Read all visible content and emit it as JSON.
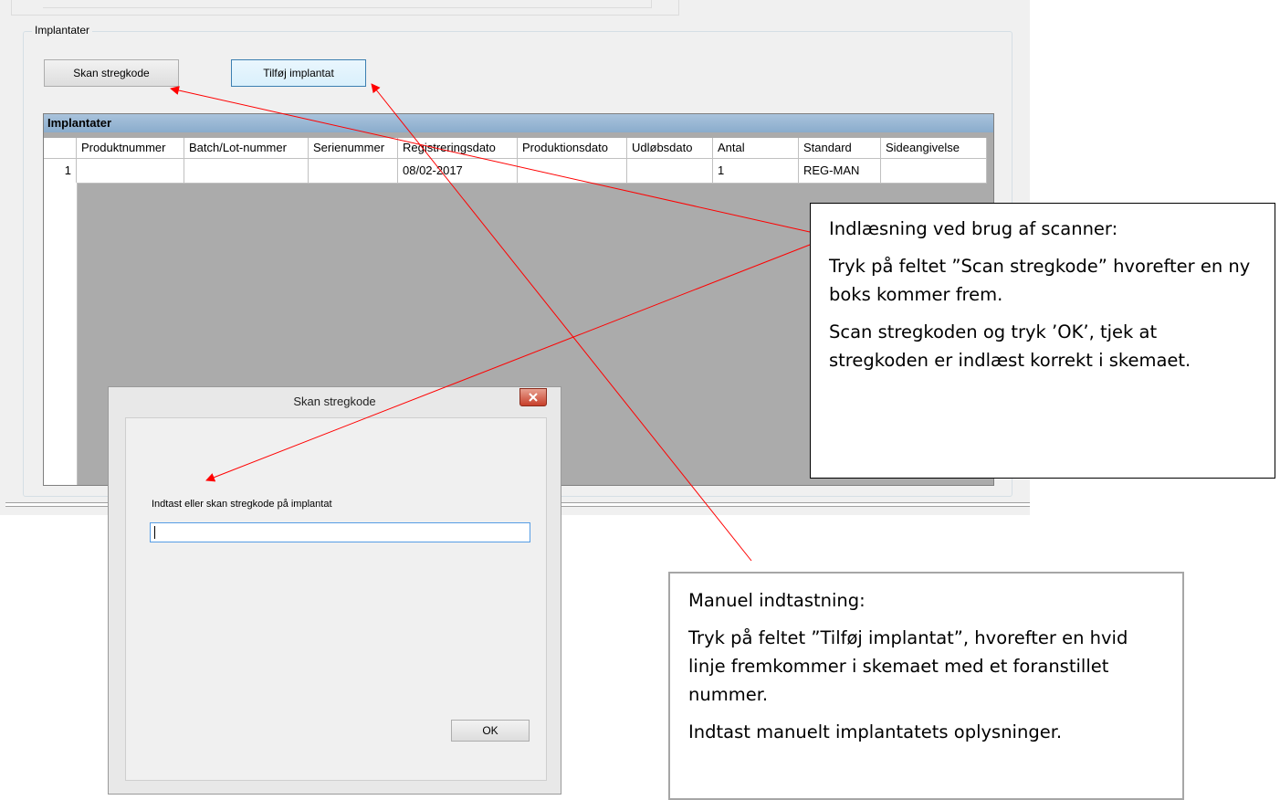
{
  "groupbox": {
    "label": "Implantater"
  },
  "buttons": {
    "scan": "Skan stregkode",
    "add": "Tilføj implantat"
  },
  "grid": {
    "caption": "Implantater",
    "columns": [
      "Produktnummer",
      "Batch/Lot-nummer",
      "Serienummer",
      "Registreringsdato",
      "Produktionsdato",
      "Udløbsdato",
      "Antal",
      "Standard",
      "Sideangivelse"
    ],
    "rows": [
      {
        "num": "1",
        "cells": [
          "",
          "",
          "",
          "08/02-2017",
          "",
          "",
          "1",
          "REG-MAN",
          ""
        ]
      }
    ]
  },
  "dialog": {
    "title": "Skan stregkode",
    "prompt": "Indtast eller skan stregkode på implantat",
    "input_value": "",
    "ok": "OK"
  },
  "annotations": {
    "scanner": [
      "Indlæsning ved brug af scanner:",
      "Tryk på feltet ”Scan stregkode” hvorefter en ny boks kommer frem.",
      "Scan stregkoden og tryk ’OK’, tjek at stregkoden er indlæst korrekt i skemaet."
    ],
    "manual": [
      "Manuel indtastning:",
      "Tryk på feltet ”Tilføj implantat”, hvorefter en hvid linje fremkommer i skemaet med et foranstillet nummer.",
      "Indtast manuelt implantatets oplysninger."
    ]
  },
  "colors": {
    "arrow": "#ff0000",
    "grid_caption": "#8eb0d0",
    "grid_background": "#ababab"
  },
  "icons": {
    "close": "close-icon"
  }
}
